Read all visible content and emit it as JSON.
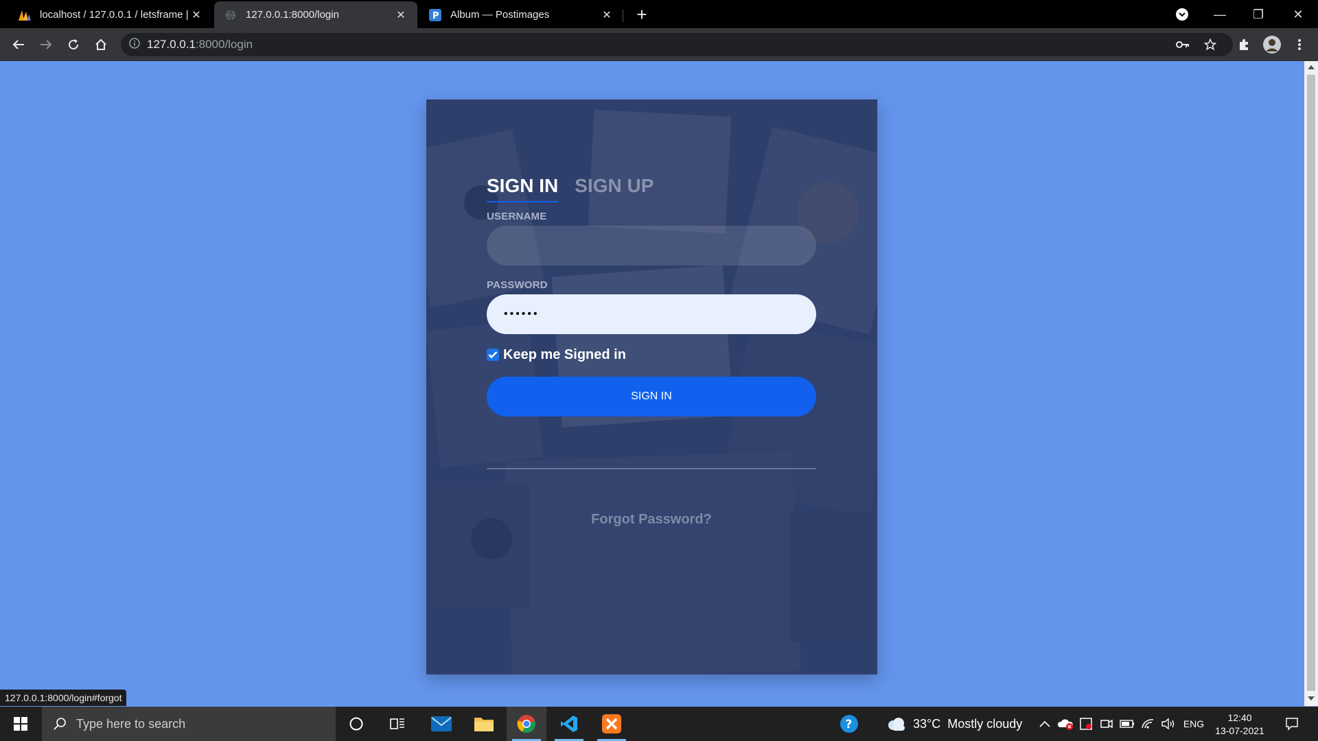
{
  "browser": {
    "tabs": [
      {
        "title": "localhost / 127.0.0.1 / letsframe |",
        "icon": "phpmyadmin-icon",
        "active": false
      },
      {
        "title": "127.0.0.1:8000/login",
        "icon": "globe-icon",
        "active": true
      },
      {
        "title": "Album — Postimages",
        "icon": "postimages-icon",
        "active": false
      }
    ],
    "url_host": "127.0.0.1",
    "url_path": ":8000/login"
  },
  "login": {
    "tab_signin": "SIGN IN",
    "tab_signup": "SIGN UP",
    "username_label": "USERNAME",
    "username_value": "",
    "password_label": "PASSWORD",
    "password_value": "••••••",
    "keep_signed_in_label": "Keep me Signed in",
    "keep_signed_in_checked": true,
    "signin_button": "SIGN IN",
    "forgot_password": "Forgot Password?"
  },
  "status_url": "127.0.0.1:8000/login#forgot",
  "taskbar": {
    "search_placeholder": "Type here to search",
    "weather": "33°C  Mostly cloudy",
    "language": "ENG",
    "time": "12:40",
    "date": "13-07-2021"
  },
  "colors": {
    "page_background": "#6495ed",
    "accent": "#1161ee"
  }
}
